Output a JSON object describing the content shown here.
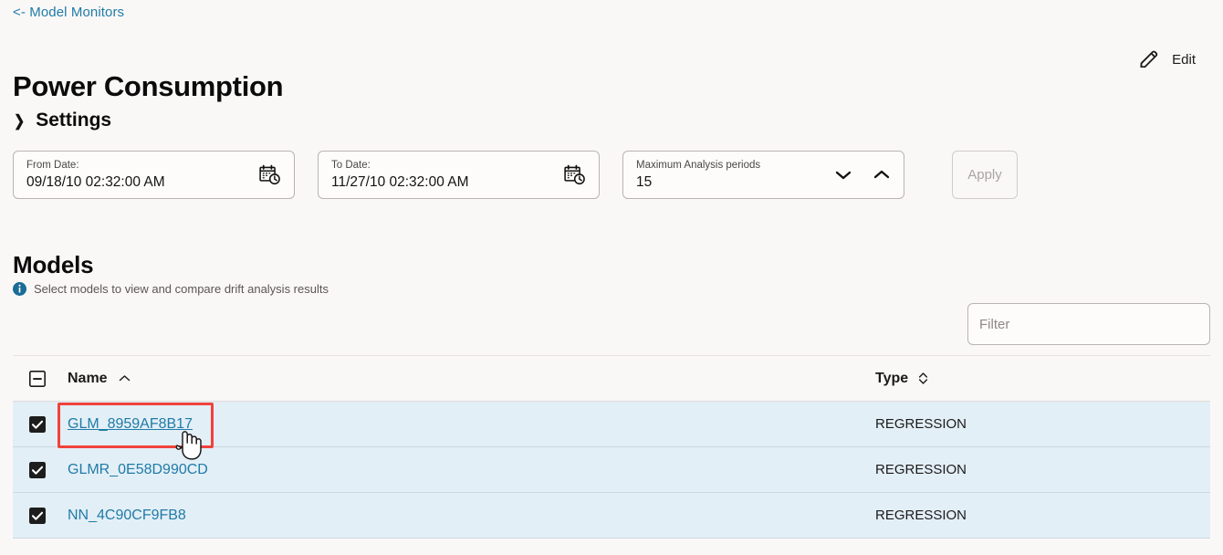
{
  "breadcrumb": {
    "label": "<- Model Monitors"
  },
  "header": {
    "title": "Power Consumption",
    "edit_label": "Edit",
    "edit_icon": "pencil-icon"
  },
  "settings": {
    "label": "Settings",
    "expanded": false,
    "chevron_icon": "chevron-right-icon"
  },
  "filters": {
    "from_date": {
      "label": "From Date:",
      "value": "09/18/10 02:32:00 AM",
      "icon": "calendar-clock-icon"
    },
    "to_date": {
      "label": "To Date:",
      "value": "11/27/10 02:32:00 AM",
      "icon": "calendar-clock-icon"
    },
    "max_periods": {
      "label": "Maximum Analysis periods",
      "value": "15",
      "decrement_icon": "chevron-down-icon",
      "increment_icon": "chevron-up-icon"
    },
    "apply_label": "Apply",
    "apply_disabled": true
  },
  "models": {
    "title": "Models",
    "hint_icon": "info-icon",
    "hint": "Select models to view and compare drift analysis results",
    "filter_placeholder": "Filter",
    "filter_value": "",
    "columns": {
      "select_all_state": "indeterminate",
      "name": "Name",
      "name_sort_icon": "chevron-up-icon",
      "type": "Type",
      "type_sort_icon": "sort-both-icon"
    },
    "rows": [
      {
        "checked": true,
        "name": "GLM_8959AF8B17",
        "type": "REGRESSION",
        "hovered": true
      },
      {
        "checked": true,
        "name": "GLMR_0E58D990CD",
        "type": "REGRESSION",
        "hovered": false
      },
      {
        "checked": true,
        "name": "NN_4C90CF9FB8",
        "type": "REGRESSION",
        "hovered": false
      }
    ]
  },
  "annotation": {
    "highlight_target": "GLM_8959AF8B17",
    "highlight_color": "#f0423c",
    "cursor_icon": "pointing-hand-cursor"
  },
  "colors": {
    "page_background": "#faf8f7",
    "link": "#1f7ba8",
    "row_selected": "#e3eff6",
    "text": "#1b1b1b",
    "muted": "#5a5654",
    "highlight": "#f0423c"
  }
}
